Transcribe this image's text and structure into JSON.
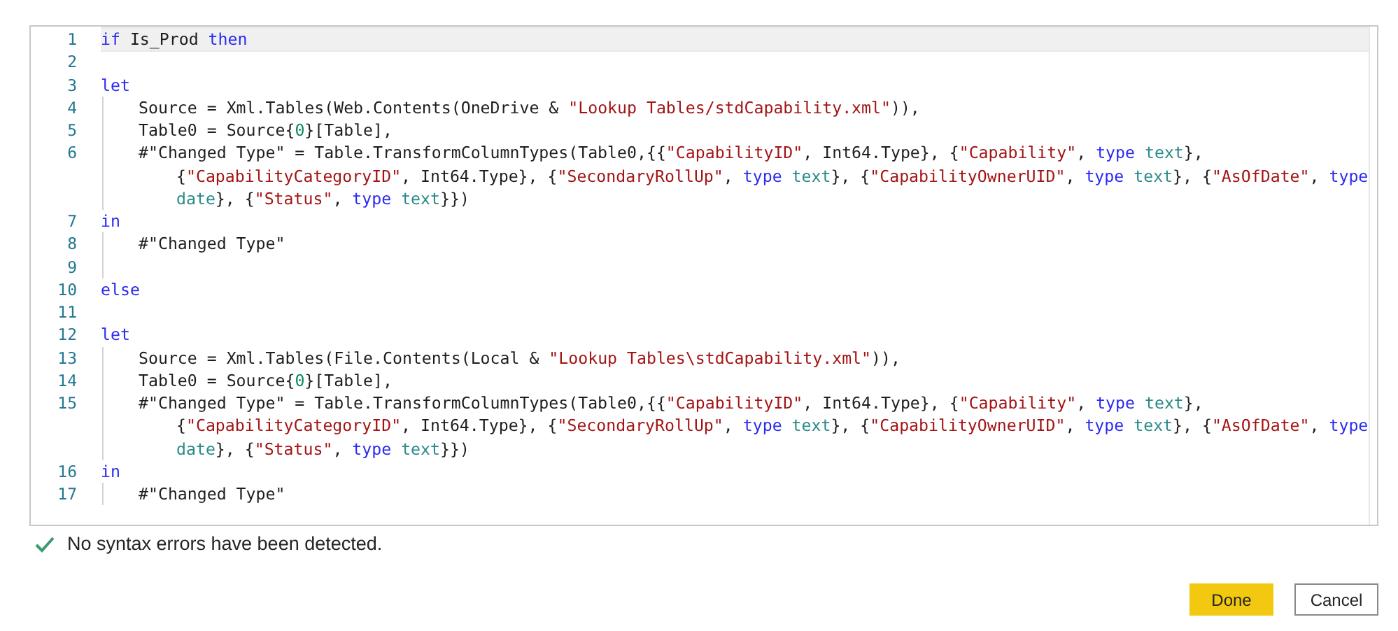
{
  "editor": {
    "lines": [
      {
        "number": "1",
        "current": true,
        "indented": false,
        "rows": [
          {
            "spans": [
              {
                "kind": "keyword",
                "text": "if"
              },
              {
                "kind": "plain",
                "text": " Is_Prod "
              },
              {
                "kind": "keyword",
                "text": "then"
              }
            ]
          }
        ]
      },
      {
        "number": "2",
        "current": false,
        "indented": false
      },
      {
        "number": "3",
        "current": false,
        "indented": false,
        "rows": [
          {
            "spans": [
              {
                "kind": "keyword",
                "text": "let"
              }
            ]
          }
        ]
      },
      {
        "number": "4",
        "current": false,
        "indented": true,
        "rows": [
          {
            "spans": [
              {
                "kind": "plain",
                "text": "Source = Xml.Tables(Web.Contents(OneDrive & "
              },
              {
                "kind": "string",
                "text": "\"Lookup Tables/stdCapability.xml\""
              },
              {
                "kind": "plain",
                "text": ")),"
              }
            ]
          }
        ]
      },
      {
        "number": "5",
        "current": false,
        "indented": true,
        "rows": [
          {
            "spans": [
              {
                "kind": "plain",
                "text": "Table0 = Source{"
              },
              {
                "kind": "number",
                "text": "0"
              },
              {
                "kind": "plain",
                "text": "}[Table],"
              }
            ]
          }
        ]
      },
      {
        "number": "6",
        "current": false,
        "indented": true,
        "rows": [
          {
            "spans": [
              {
                "kind": "plain",
                "text": "#\"Changed Type\" = Table.TransformColumnTypes(Table0,{{"
              },
              {
                "kind": "string",
                "text": "\"CapabilityID\""
              },
              {
                "kind": "plain",
                "text": ", Int64.Type}, {"
              },
              {
                "kind": "string",
                "text": "\"Capability\""
              },
              {
                "kind": "plain",
                "text": ", "
              },
              {
                "kind": "keyword",
                "text": "type "
              },
              {
                "kind": "type",
                "text": "text"
              },
              {
                "kind": "plain",
                "text": "},"
              }
            ]
          },
          {
            "spans": [
              {
                "kind": "plain",
                "text": "{"
              },
              {
                "kind": "string",
                "text": "\"CapabilityCategoryID\""
              },
              {
                "kind": "plain",
                "text": ", Int64.Type}, {"
              },
              {
                "kind": "string",
                "text": "\"SecondaryRollUp\""
              },
              {
                "kind": "plain",
                "text": ", "
              },
              {
                "kind": "keyword",
                "text": "type "
              },
              {
                "kind": "type",
                "text": "text"
              },
              {
                "kind": "plain",
                "text": "}, {"
              },
              {
                "kind": "string",
                "text": "\"CapabilityOwnerUID\""
              },
              {
                "kind": "plain",
                "text": ", "
              },
              {
                "kind": "keyword",
                "text": "type "
              },
              {
                "kind": "type",
                "text": "text"
              },
              {
                "kind": "plain",
                "text": "}, {"
              },
              {
                "kind": "string",
                "text": "\"AsOfDate\""
              },
              {
                "kind": "plain",
                "text": ", "
              },
              {
                "kind": "keyword",
                "text": "type"
              }
            ]
          },
          {
            "spans": [
              {
                "kind": "type",
                "text": "date"
              },
              {
                "kind": "plain",
                "text": "}, {"
              },
              {
                "kind": "string",
                "text": "\"Status\""
              },
              {
                "kind": "plain",
                "text": ", "
              },
              {
                "kind": "keyword",
                "text": "type "
              },
              {
                "kind": "type",
                "text": "text"
              },
              {
                "kind": "plain",
                "text": "}})"
              }
            ]
          }
        ]
      },
      {
        "number": "7",
        "current": false,
        "indented": false,
        "rows": [
          {
            "spans": [
              {
                "kind": "keyword",
                "text": "in"
              }
            ]
          }
        ]
      },
      {
        "number": "8",
        "current": false,
        "indented": true,
        "rows": [
          {
            "spans": [
              {
                "kind": "plain",
                "text": "#\"Changed Type\""
              }
            ]
          }
        ]
      },
      {
        "number": "9",
        "current": false,
        "indented": true
      },
      {
        "number": "10",
        "current": false,
        "indented": false,
        "rows": [
          {
            "spans": [
              {
                "kind": "keyword",
                "text": "else"
              }
            ]
          }
        ]
      },
      {
        "number": "11",
        "current": false,
        "indented": false
      },
      {
        "number": "12",
        "current": false,
        "indented": false,
        "rows": [
          {
            "spans": [
              {
                "kind": "keyword",
                "text": "let"
              }
            ]
          }
        ]
      },
      {
        "number": "13",
        "current": false,
        "indented": true,
        "rows": [
          {
            "spans": [
              {
                "kind": "plain",
                "text": "Source = Xml.Tables(File.Contents(Local & "
              },
              {
                "kind": "string",
                "text": "\"Lookup Tables\\stdCapability.xml\""
              },
              {
                "kind": "plain",
                "text": ")),"
              }
            ]
          }
        ]
      },
      {
        "number": "14",
        "current": false,
        "indented": true,
        "rows": [
          {
            "spans": [
              {
                "kind": "plain",
                "text": "Table0 = Source{"
              },
              {
                "kind": "number",
                "text": "0"
              },
              {
                "kind": "plain",
                "text": "}[Table],"
              }
            ]
          }
        ]
      },
      {
        "number": "15",
        "current": false,
        "indented": true,
        "rows": [
          {
            "spans": [
              {
                "kind": "plain",
                "text": "#\"Changed Type\" = Table.TransformColumnTypes(Table0,{{"
              },
              {
                "kind": "string",
                "text": "\"CapabilityID\""
              },
              {
                "kind": "plain",
                "text": ", Int64.Type}, {"
              },
              {
                "kind": "string",
                "text": "\"Capability\""
              },
              {
                "kind": "plain",
                "text": ", "
              },
              {
                "kind": "keyword",
                "text": "type "
              },
              {
                "kind": "type",
                "text": "text"
              },
              {
                "kind": "plain",
                "text": "},"
              }
            ]
          },
          {
            "spans": [
              {
                "kind": "plain",
                "text": "{"
              },
              {
                "kind": "string",
                "text": "\"CapabilityCategoryID\""
              },
              {
                "kind": "plain",
                "text": ", Int64.Type}, {"
              },
              {
                "kind": "string",
                "text": "\"SecondaryRollUp\""
              },
              {
                "kind": "plain",
                "text": ", "
              },
              {
                "kind": "keyword",
                "text": "type "
              },
              {
                "kind": "type",
                "text": "text"
              },
              {
                "kind": "plain",
                "text": "}, {"
              },
              {
                "kind": "string",
                "text": "\"CapabilityOwnerUID\""
              },
              {
                "kind": "plain",
                "text": ", "
              },
              {
                "kind": "keyword",
                "text": "type "
              },
              {
                "kind": "type",
                "text": "text"
              },
              {
                "kind": "plain",
                "text": "}, {"
              },
              {
                "kind": "string",
                "text": "\"AsOfDate\""
              },
              {
                "kind": "plain",
                "text": ", "
              },
              {
                "kind": "keyword",
                "text": "type"
              }
            ]
          },
          {
            "spans": [
              {
                "kind": "type",
                "text": "date"
              },
              {
                "kind": "plain",
                "text": "}, {"
              },
              {
                "kind": "string",
                "text": "\"Status\""
              },
              {
                "kind": "plain",
                "text": ", "
              },
              {
                "kind": "keyword",
                "text": "type "
              },
              {
                "kind": "type",
                "text": "text"
              },
              {
                "kind": "plain",
                "text": "}})"
              }
            ]
          }
        ]
      },
      {
        "number": "16",
        "current": false,
        "indented": false,
        "rows": [
          {
            "spans": [
              {
                "kind": "keyword",
                "text": "in"
              }
            ]
          }
        ]
      },
      {
        "number": "17",
        "current": false,
        "indented": true,
        "rows": [
          {
            "spans": [
              {
                "kind": "plain",
                "text": "#\"Changed Type\""
              }
            ]
          }
        ]
      }
    ]
  },
  "status": {
    "valid": true,
    "message": "No syntax errors have been detected."
  },
  "buttons": [
    {
      "label": "Done",
      "primary": true
    },
    {
      "label": "Cancel",
      "primary": false
    }
  ]
}
